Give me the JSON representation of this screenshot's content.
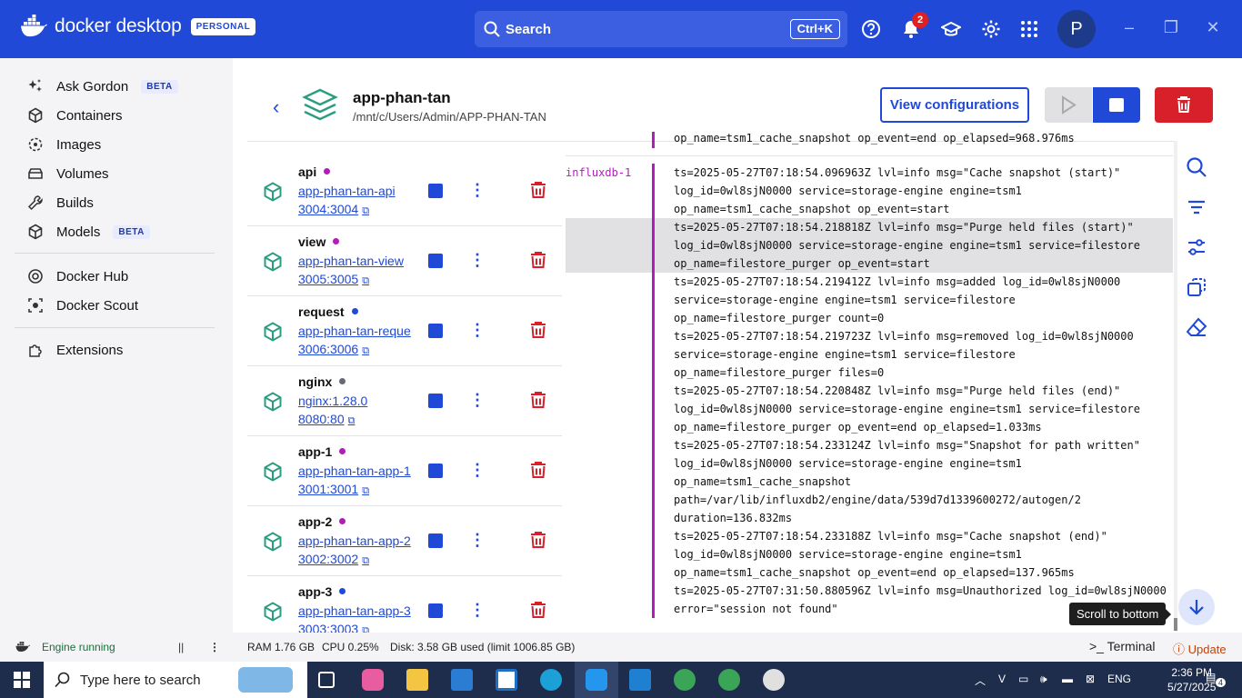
{
  "titlebar": {
    "brand": "docker desktop",
    "plan_badge": "PERSONAL",
    "search_label": "Search",
    "search_shortcut": "Ctrl+K",
    "notifications_count": "2",
    "avatar_initial": "P"
  },
  "sidebar": {
    "items": [
      {
        "label": "Ask Gordon",
        "badge": "BETA",
        "icon": "gordon-icon"
      },
      {
        "label": "Containers",
        "icon": "containers-icon"
      },
      {
        "label": "Images",
        "icon": "images-icon"
      },
      {
        "label": "Volumes",
        "icon": "volumes-icon"
      },
      {
        "label": "Builds",
        "icon": "builds-icon"
      },
      {
        "label": "Models",
        "badge": "BETA",
        "icon": "models-icon"
      },
      {
        "label": "Docker Hub",
        "icon": "docker-hub-icon"
      },
      {
        "label": "Docker Scout",
        "icon": "docker-scout-icon"
      },
      {
        "label": "Extensions",
        "icon": "extensions-icon"
      }
    ]
  },
  "header": {
    "title": "app-phan-tan",
    "path": "/mnt/c/Users/Admin/APP-PHAN-TAN",
    "view_configurations": "View configurations"
  },
  "services": [
    {
      "name": "api",
      "status_color": "#b21cba",
      "link": "app-phan-tan-api",
      "ports": "3004:3004"
    },
    {
      "name": "view",
      "status_color": "#b21cba",
      "link": "app-phan-tan-view",
      "ports": "3005:3005"
    },
    {
      "name": "request",
      "status_color": "#1f49d6",
      "link": "app-phan-tan-reque",
      "ports": "3006:3006"
    },
    {
      "name": "nginx",
      "status_color": "#666a73",
      "link": "nginx:1.28.0",
      "ports": "8080:80"
    },
    {
      "name": "app-1",
      "status_color": "#b21cba",
      "link": "app-phan-tan-app-1",
      "ports": "3001:3001"
    },
    {
      "name": "app-2",
      "status_color": "#b21cba",
      "link": "app-phan-tan-app-2",
      "ports": "3002:3002"
    },
    {
      "name": "app-3",
      "status_color": "#1f49d6",
      "link": "app-phan-tan-app-3",
      "ports": "3003:3003"
    }
  ],
  "logs": {
    "top_partial": "op_name=tsm1_cache_snapshot op_event=end op_elapsed=968.976ms",
    "container_label": "influxdb-1",
    "lines": [
      "ts=2025-05-27T07:18:54.096963Z lvl=info msg=\"Cache snapshot (start)\"",
      "log_id=0wl8sjN0000 service=storage-engine engine=tsm1",
      "op_name=tsm1_cache_snapshot op_event=start",
      "ts=2025-05-27T07:18:54.218818Z lvl=info msg=\"Purge held files (start)\"",
      "log_id=0wl8sjN0000 service=storage-engine engine=tsm1 service=filestore",
      "op_name=filestore_purger op_event=start",
      "ts=2025-05-27T07:18:54.219412Z lvl=info msg=added log_id=0wl8sjN0000",
      "service=storage-engine engine=tsm1 service=filestore",
      "op_name=filestore_purger count=0",
      "ts=2025-05-27T07:18:54.219723Z lvl=info msg=removed log_id=0wl8sjN0000",
      "service=storage-engine engine=tsm1 service=filestore",
      "op_name=filestore_purger files=0",
      "ts=2025-05-27T07:18:54.220848Z lvl=info msg=\"Purge held files (end)\"",
      "log_id=0wl8sjN0000 service=storage-engine engine=tsm1 service=filestore",
      "op_name=filestore_purger op_event=end op_elapsed=1.033ms",
      "ts=2025-05-27T07:18:54.233124Z lvl=info msg=\"Snapshot for path written\"",
      "log_id=0wl8sjN0000 service=storage-engine engine=tsm1",
      "op_name=tsm1_cache_snapshot",
      "path=/var/lib/influxdb2/engine/data/539d7d1339600272/autogen/2",
      "duration=136.832ms",
      "ts=2025-05-27T07:18:54.233188Z lvl=info msg=\"Cache snapshot (end)\"",
      "log_id=0wl8sjN0000 service=storage-engine engine=tsm1",
      "op_name=tsm1_cache_snapshot op_event=end op_elapsed=137.965ms",
      "ts=2025-05-27T07:31:50.880596Z lvl=info msg=Unauthorized log_id=0wl8sjN0000",
      "error=\"session not found\""
    ],
    "scroll_tooltip": "Scroll to bottom"
  },
  "status": {
    "engine": "Engine running",
    "pause": "||",
    "ram": "RAM 1.76 GB",
    "cpu": "CPU 0.25%",
    "disk": "Disk: 3.58 GB used (limit 1006.85 GB)",
    "terminal": "Terminal",
    "update": "Update"
  },
  "taskbar": {
    "search_placeholder": "Type here to search",
    "language": "ENG",
    "time": "2:36 PM",
    "date": "5/27/2025",
    "notif_count": "4"
  }
}
